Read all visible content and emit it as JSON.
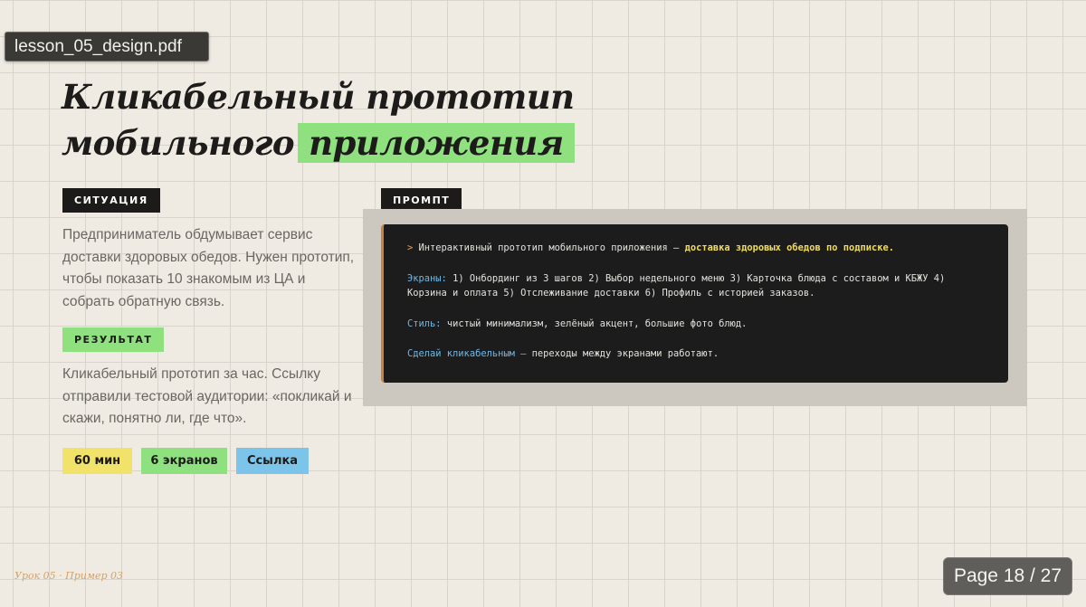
{
  "viewer": {
    "filename": "lesson_05_design.pdf",
    "page_indicator": "Page 18 / 27"
  },
  "slide": {
    "title_line1": "Кликабельный прототип",
    "title_line2_plain": "мобильного",
    "title_line2_highlight": "приложения",
    "situation_label": "СИТУАЦИЯ",
    "situation_text": "Предприниматель обдумывает сервис доставки здоровых обедов. Нужен прототип, чтобы показать 10 знакомым из ЦА и собрать обратную связь.",
    "result_label": "РЕЗУЛЬТАТ",
    "result_text": "Кликабельный прототип за час. Ссылку отправили тестовой аудитории: «покликай и скажи, понятно ли, где что».",
    "badges": [
      {
        "text": "60 мин",
        "color": "#f1e36a"
      },
      {
        "text": "6 экранов",
        "color": "#8fe07f"
      },
      {
        "text": "Ссылка",
        "color": "#7cc4ea"
      }
    ],
    "prompt_label": "ПРОМПТ",
    "prompt": {
      "p1_arrow": ">",
      "p1_text": "Интерактивный прототип мобильного приложения —",
      "p1_accent": "доставка здоровых обедов по подписке.",
      "p2_key": "Экраны:",
      "p2_text": "1) Онбординг из 3 шагов 2) Выбор недельного меню 3) Карточка блюда с составом и КБЖУ 4) Корзина и оплата 5) Отслеживание доставки 6) Профиль с историей заказов.",
      "p3_key": "Стиль:",
      "p3_text": "чистый минимализм, зелёный акцент, большие фото блюд.",
      "p4_key": "Сделай кликабельным —",
      "p4_text": "переходы между экранами работают."
    },
    "footer": "Урок 05 · Пример 03"
  },
  "colors": {
    "background": "#efebe3",
    "grid_line": "#d9d4cb",
    "title_highlight": "#8fe07f",
    "label_dark": "#1c1b1a",
    "prompt_bg": "#1c1c1c",
    "prompt_accent_yellow": "#f0dc5c",
    "prompt_key_blue": "#6fb8e6",
    "prompt_border_orange": "#c9813f",
    "footer_text": "#d6a266"
  }
}
